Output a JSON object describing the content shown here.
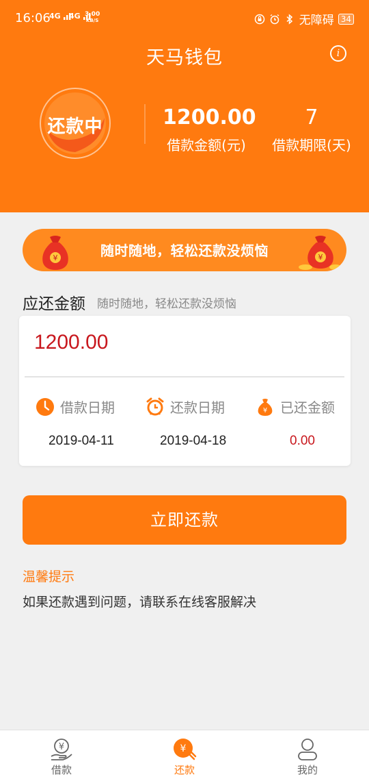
{
  "status_bar": {
    "time": "16:06",
    "signal1": "4G",
    "signal2": "4G",
    "net_speed": "3.00",
    "net_unit": "KB/S",
    "accessibility": "无障碍",
    "battery": "34"
  },
  "header": {
    "title": "天马钱包",
    "info_icon": "i",
    "status": "还款中",
    "loan_amount": "1200.00",
    "loan_amount_label": "借款金额(元)",
    "loan_term": "7",
    "loan_term_label": "借款期限(天)"
  },
  "banner": {
    "text": "随时随地，轻松还款没烦恼",
    "bag_symbol": "¥"
  },
  "repay": {
    "section_title": "应还金额",
    "section_subtitle": "随时随地，轻松还款没烦恼",
    "amount": "1200.00",
    "columns": [
      {
        "label": "借款日期",
        "value": "2019-04-11",
        "icon": "clock-icon"
      },
      {
        "label": "还款日期",
        "value": "2019-04-18",
        "icon": "alarm-clock-icon"
      },
      {
        "label": "已还金额",
        "value": "0.00",
        "icon": "money-bag-icon"
      }
    ],
    "button_label": "立即还款"
  },
  "tips": {
    "title": "温馨提示",
    "text": "如果还款遇到问题，请联系在线客服解决"
  },
  "tabbar": {
    "items": [
      {
        "label": "借款",
        "icon": "loan-icon"
      },
      {
        "label": "还款",
        "icon": "repay-icon"
      },
      {
        "label": "我的",
        "icon": "profile-icon"
      }
    ]
  },
  "colors": {
    "primary": "#ff7a0f",
    "amount_red": "#c8171d",
    "background": "#f0f0f0"
  }
}
